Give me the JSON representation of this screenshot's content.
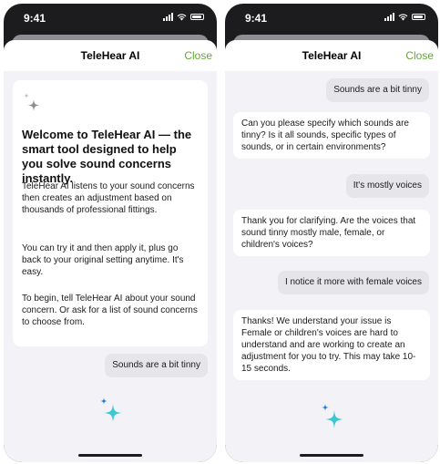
{
  "status": {
    "time": "9:41"
  },
  "sheet": {
    "title": "TeleHear AI",
    "close_label": "Close"
  },
  "left_screen": {
    "welcome_title": "Welcome to TeleHear AI — the smart tool designed to help you solve sound concerns instantly.",
    "paragraphs": [
      "TeleHear AI listens to your sound concerns then creates an adjustment based on thousands of professional fittings.",
      "You can try it and then apply it, plus go back to your original setting anytime. It's easy.",
      "To begin, tell TeleHear AI about your sound concern. Or ask for a list of sound concerns to choose from."
    ],
    "user_message": "Sounds are a bit tinny"
  },
  "right_screen": {
    "messages": [
      {
        "role": "user",
        "text": "Sounds are a bit tinny"
      },
      {
        "role": "ai",
        "text": "Can you please specify which sounds are tinny? Is it all sounds, specific types of sounds, or in certain environments?"
      },
      {
        "role": "user",
        "text": "It's mostly voices"
      },
      {
        "role": "ai",
        "text": "Thank you for clarifying. Are the voices that sound tinny mostly male, female, or children's voices?"
      },
      {
        "role": "user",
        "text": "I notice it more with female voices"
      },
      {
        "role": "ai",
        "text": "Thanks! We understand your issue is Female or children's voices are hard to understand and are working to create an adjustment for you to try. This may take 10-15 seconds."
      }
    ]
  },
  "icons": {
    "sparkle_gray": "sparkle-icon",
    "sparkle_teal": "sparkle-icon",
    "signal": "signal-icon",
    "wifi": "wifi-icon",
    "battery": "battery-icon"
  },
  "colors": {
    "accent_close": "#66a637",
    "teal_large": "#3cc8d2",
    "teal_small": "#1f7bd6",
    "bubble_user": "#e5e5ea",
    "background": "#f2f2f7"
  }
}
